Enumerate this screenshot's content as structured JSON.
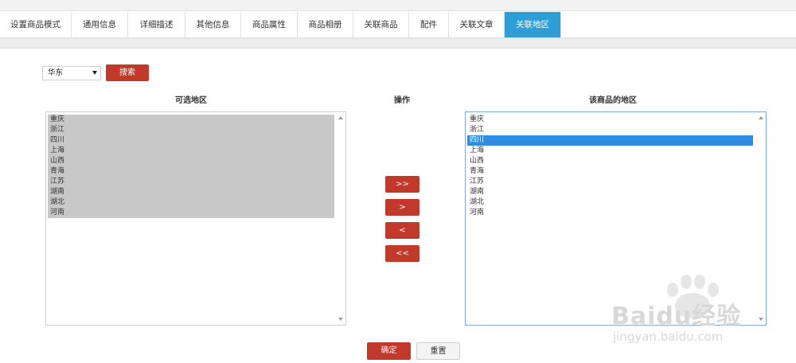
{
  "tabs": [
    {
      "label": "设置商品模式",
      "active": false
    },
    {
      "label": "通用信息",
      "active": false
    },
    {
      "label": "详细描述",
      "active": false
    },
    {
      "label": "其他信息",
      "active": false
    },
    {
      "label": "商品属性",
      "active": false
    },
    {
      "label": "商品相册",
      "active": false
    },
    {
      "label": "关联商品",
      "active": false
    },
    {
      "label": "配件",
      "active": false
    },
    {
      "label": "关联文章",
      "active": false
    },
    {
      "label": "关联地区",
      "active": true
    }
  ],
  "filter": {
    "region_value": "华东",
    "search_label": "搜索"
  },
  "columns": {
    "available_title": "可选地区",
    "operation_title": "操作",
    "selected_title": "该商品的地区"
  },
  "available_list": [
    "重庆",
    "浙江",
    "四川",
    "上海",
    "山西",
    "青海",
    "江苏",
    "湖南",
    "湖北",
    "河南"
  ],
  "selected_list": [
    "重庆",
    "浙江",
    "四川",
    "上海",
    "山西",
    "青海",
    "江苏",
    "湖南",
    "湖北",
    "河南"
  ],
  "selected_list_highlight": "四川",
  "operations": {
    "add_all": ">>",
    "add_one": ">",
    "remove_one": "<",
    "remove_all": "<<"
  },
  "footer": {
    "confirm_label": "确定",
    "reset_label": "重置"
  },
  "watermark": {
    "brand": "Baidu经验",
    "url": "jingyan.baidu.com"
  },
  "colors": {
    "active_tab": "#2d9fd6",
    "primary_button": "#c0392b",
    "selection": "#2f8ee3",
    "left_selection": "#c9c8c9"
  }
}
